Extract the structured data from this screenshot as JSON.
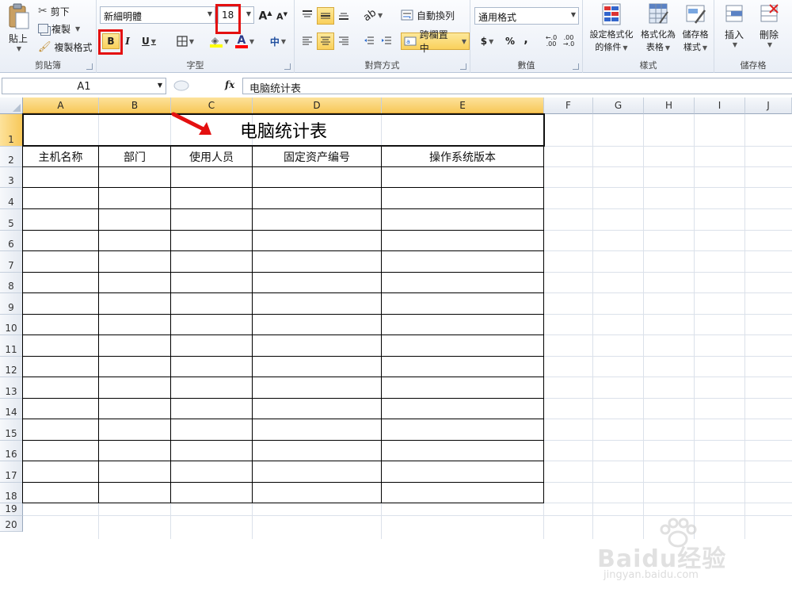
{
  "ribbon": {
    "clipboard": {
      "label": "剪貼簿",
      "paste": "貼上",
      "cut": "剪下",
      "copy": "複製",
      "format_painter": "複製格式"
    },
    "font": {
      "label": "字型",
      "font_name": "新細明體",
      "font_size": "18",
      "bold": "B",
      "italic": "I",
      "underline": "U",
      "fill_color": "#ffff00",
      "font_color": "#ff0000",
      "phonetic": "中"
    },
    "alignment": {
      "label": "對齊方式",
      "wrap_text": "自動換列",
      "merge_center": "跨欄置中"
    },
    "number": {
      "label": "數值",
      "format": "通用格式",
      "currency": "$",
      "percent": "%",
      "comma": ","
    },
    "styles": {
      "label": "樣式",
      "conditional_line1": "設定格式化",
      "conditional_line2": "的條件",
      "table_line1": "格式化為",
      "table_line2": "表格",
      "cell_line1": "儲存格",
      "cell_line2": "樣式"
    },
    "cells": {
      "label": "儲存格",
      "insert": "插入",
      "delete": "刪除"
    }
  },
  "formula_bar": {
    "name_box": "A1",
    "fx": "fx",
    "content": "电脑统计表"
  },
  "sheet": {
    "columns": [
      "A",
      "B",
      "C",
      "D",
      "E",
      "F",
      "G",
      "H",
      "I",
      "J"
    ],
    "rows": [
      "1",
      "2",
      "3",
      "4",
      "5",
      "6",
      "7",
      "8",
      "9",
      "10",
      "11",
      "12",
      "13",
      "14",
      "15",
      "16",
      "17",
      "18",
      "19",
      "20"
    ],
    "title": "电脑统计表",
    "headers": [
      "主机名称",
      "部门",
      "使用人员",
      "固定资产编号",
      "操作系统版本"
    ]
  },
  "watermark": {
    "text": "Baidu经验",
    "url": "jingyan.baidu.com"
  }
}
